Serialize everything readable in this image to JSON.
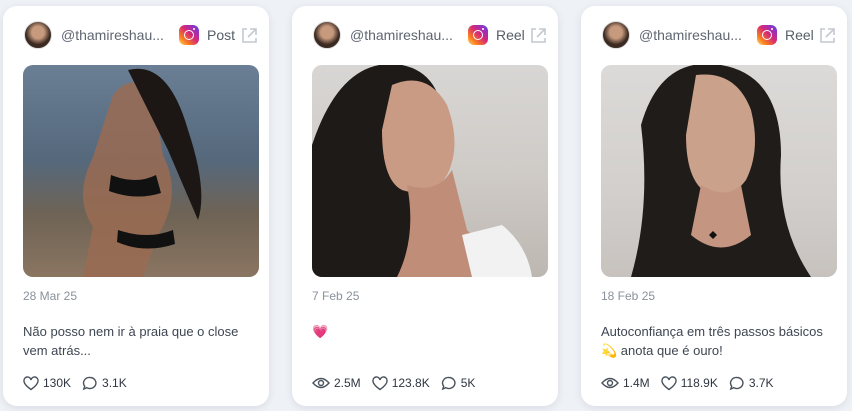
{
  "cards": [
    {
      "handle": "@thamireshau...",
      "type": "Post",
      "date": "28 Mar 25",
      "caption": "Não posso nem ir à praia que o close vem atrás...",
      "likes": "130K",
      "comments": "3.1K",
      "platform_icon": "instagram-icon"
    },
    {
      "handle": "@thamireshau...",
      "type": "Reel",
      "date": "7 Feb 25",
      "caption": "💗",
      "views": "2.5M",
      "likes": "123.8K",
      "comments": "5K",
      "platform_icon": "instagram-icon"
    },
    {
      "handle": "@thamireshau...",
      "type": "Reel",
      "date": "18 Feb 25",
      "caption": "Autoconfiança em três passos básicos 💫 anota que é ouro!",
      "views": "1.4M",
      "likes": "118.9K",
      "comments": "3.7K",
      "platform_icon": "instagram-icon"
    }
  ],
  "colors": {
    "card_bg": "#ffffff",
    "page_bg": "#eef1f5",
    "muted_text": "#8a919c"
  }
}
